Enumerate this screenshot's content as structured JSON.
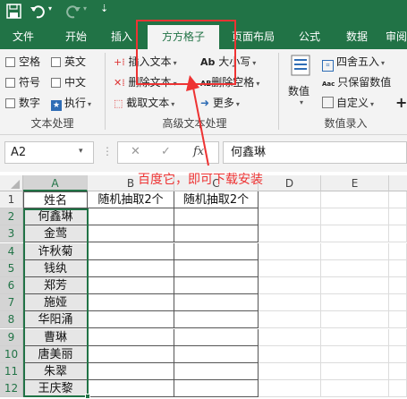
{
  "ribbon_tabs": [
    {
      "label": "文件"
    },
    {
      "label": "开始"
    },
    {
      "label": "插入"
    },
    {
      "label": "方方格子"
    },
    {
      "label": "页面布局"
    },
    {
      "label": "公式"
    },
    {
      "label": "数据"
    },
    {
      "label": "审阅"
    }
  ],
  "ribbon": {
    "text_processing": {
      "checkboxes": [
        "空格",
        "英文",
        "符号",
        "中文",
        "数字"
      ],
      "exec": "执行",
      "group_label": "文本处理"
    },
    "advanced_text": {
      "insert_text": "插入文本",
      "delete_text": "删除文本",
      "cut_text": "截取文本",
      "case": "大小写",
      "delete_space": "删除空格",
      "more": "更多",
      "group_label": "高级文本处理"
    },
    "numeric": {
      "value": "数值",
      "round": "四舍五入",
      "keep_value": "只保留数值",
      "custom": "自定义",
      "group_label": "数值录入"
    }
  },
  "formula_bar": {
    "name_box": "A2",
    "fx": "fx",
    "content": "何鑫琳"
  },
  "annotation": "百度它，即可下载安装",
  "sheet": {
    "columns": [
      "A",
      "B",
      "C",
      "D",
      "E"
    ],
    "rows": [
      "1",
      "2",
      "3",
      "4",
      "5",
      "6",
      "7",
      "8",
      "9",
      "10",
      "11",
      "12"
    ],
    "header_row": [
      "姓名",
      "随机抽取2个",
      "随机抽取2个"
    ],
    "names": [
      "何鑫琳",
      "金莺",
      "许秋菊",
      "钱纨",
      "郑芳",
      "施娅",
      "华阳涌",
      "曹琳",
      "唐美丽",
      "朱翠",
      "王庆黎"
    ]
  },
  "colors": {
    "accent": "#217346",
    "callout": "#e33333"
  }
}
